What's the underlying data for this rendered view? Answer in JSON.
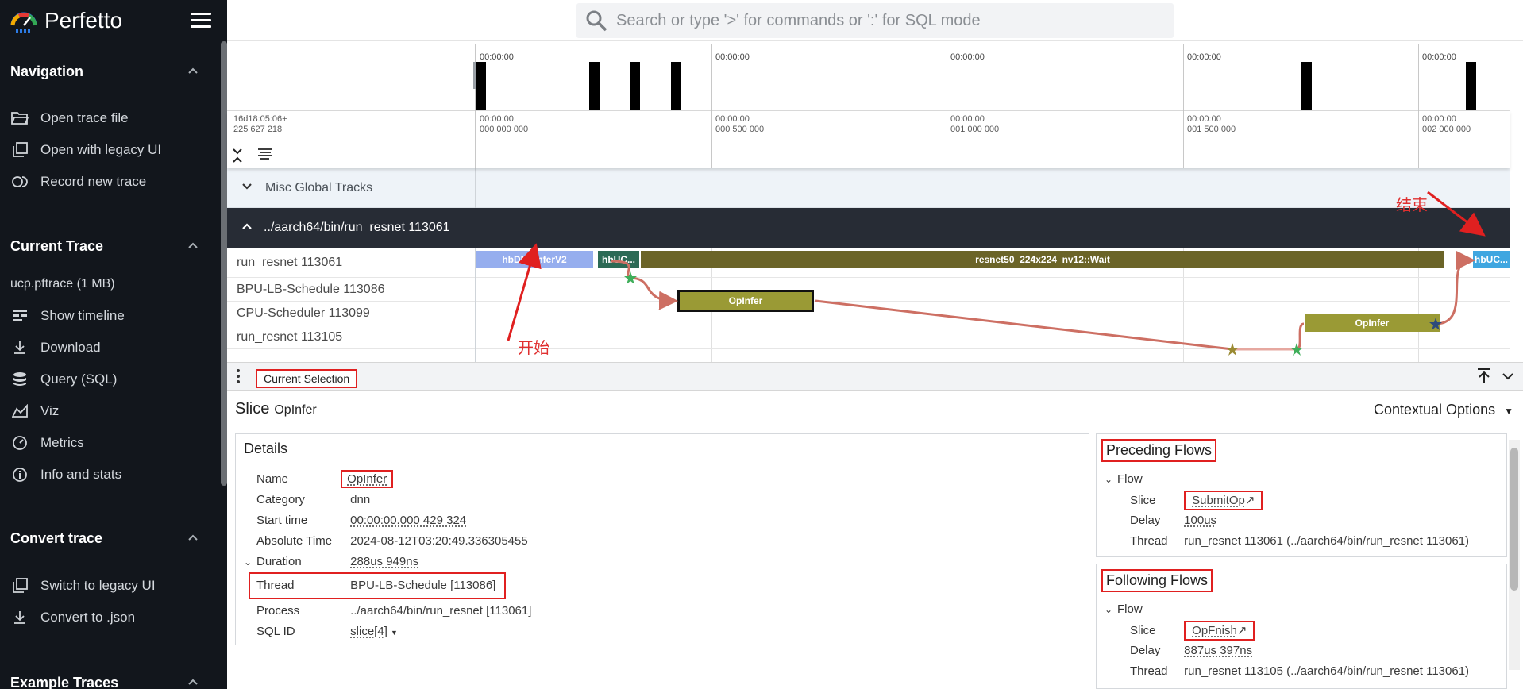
{
  "app": {
    "brand": "Perfetto"
  },
  "search": {
    "placeholder": "Search or type '>' for commands or ':' for SQL mode"
  },
  "sidebar": {
    "navigation": {
      "title": "Navigation",
      "items": [
        {
          "label": "Open trace file",
          "icon": "folder-open-icon"
        },
        {
          "label": "Open with legacy UI",
          "icon": "filter-none-icon"
        },
        {
          "label": "Record new trace",
          "icon": "record-icon"
        }
      ]
    },
    "current_trace": {
      "title": "Current Trace",
      "trace_name": "ucp.pftrace (1 MB)",
      "items": [
        {
          "label": "Show timeline",
          "icon": "timeline-icon"
        },
        {
          "label": "Download",
          "icon": "download-icon"
        },
        {
          "label": "Query (SQL)",
          "icon": "database-icon"
        },
        {
          "label": "Viz",
          "icon": "area-chart-icon"
        },
        {
          "label": "Metrics",
          "icon": "speedometer-icon"
        },
        {
          "label": "Info and stats",
          "icon": "info-icon"
        }
      ]
    },
    "convert": {
      "title": "Convert trace",
      "items": [
        {
          "label": "Switch to legacy UI",
          "icon": "filter-none-icon"
        },
        {
          "label": "Convert to .json",
          "icon": "download-icon"
        }
      ]
    },
    "examples": {
      "title": "Example Traces"
    }
  },
  "overview": {
    "labels": [
      "00:00:00",
      "00:00:00",
      "00:00:00",
      "00:00:00",
      "00:00:00"
    ]
  },
  "ruler": {
    "origin": "16d18:05:06+\n225 627 218",
    "labels": [
      "00:00:00\n000 000 000",
      "00:00:00\n000 500 000",
      "00:00:00\n001 000 000",
      "00:00:00\n001 500 000",
      "00:00:00\n002 000 000"
    ]
  },
  "tracks": {
    "misc_group": "Misc Global Tracks",
    "process_header": "../aarch64/bin/run_resnet 113061",
    "threads": [
      "run_resnet 113061",
      "BPU-LB-Schedule 113086",
      "CPU-Scheduler 113099",
      "run_resnet 113105"
    ],
    "slices": {
      "hbdnn": "hbDNNInferV2",
      "hbuc1": "hbUC...",
      "wait": "resnet50_224x224_nv12::Wait",
      "hbuc2": "hbUC...",
      "opinfer_bpu": "OpInfer",
      "opinfer_cpu": "OpInfer"
    }
  },
  "annotations": {
    "start": "开始",
    "end": "结束"
  },
  "colors": {
    "accent_red": "#e02020",
    "flow": "#cd6f63",
    "olive": "#6b6428",
    "slice_olive": "#9a9a35"
  },
  "details": {
    "tab": "Current Selection",
    "heading": "Slice",
    "heading_name": "OpInfer",
    "contextual": "Contextual Options",
    "panel_title": "Details",
    "rows": {
      "name_k": "Name",
      "name_v": "OpInfer",
      "category_k": "Category",
      "category_v": "dnn",
      "start_k": "Start time",
      "start_v": "00:00:00.000 429 324",
      "abs_k": "Absolute Time",
      "abs_v": "2024-08-12T03:20:49.336305455",
      "dur_k": "Duration",
      "dur_v": "288us 949ns",
      "thread_k": "Thread",
      "thread_v": "BPU-LB-Schedule [113086]",
      "process_k": "Process",
      "process_v": "../aarch64/bin/run_resnet [113061]",
      "sqlid_k": "SQL ID",
      "sqlid_v": "slice[4]"
    },
    "preceding": {
      "title": "Preceding Flows",
      "flow": "Flow",
      "slice_k": "Slice",
      "slice_v": "SubmitOp",
      "delay_k": "Delay",
      "delay_v": "100us",
      "thread_k": "Thread",
      "thread_v": "run_resnet 113061 (../aarch64/bin/run_resnet 113061)"
    },
    "following": {
      "title": "Following Flows",
      "flow": "Flow",
      "slice_k": "Slice",
      "slice_v": "OpFnish",
      "delay_k": "Delay",
      "delay_v": "887us 397ns",
      "thread_k": "Thread",
      "thread_v": "run_resnet 113105 (../aarch64/bin/run_resnet 113061)"
    }
  }
}
